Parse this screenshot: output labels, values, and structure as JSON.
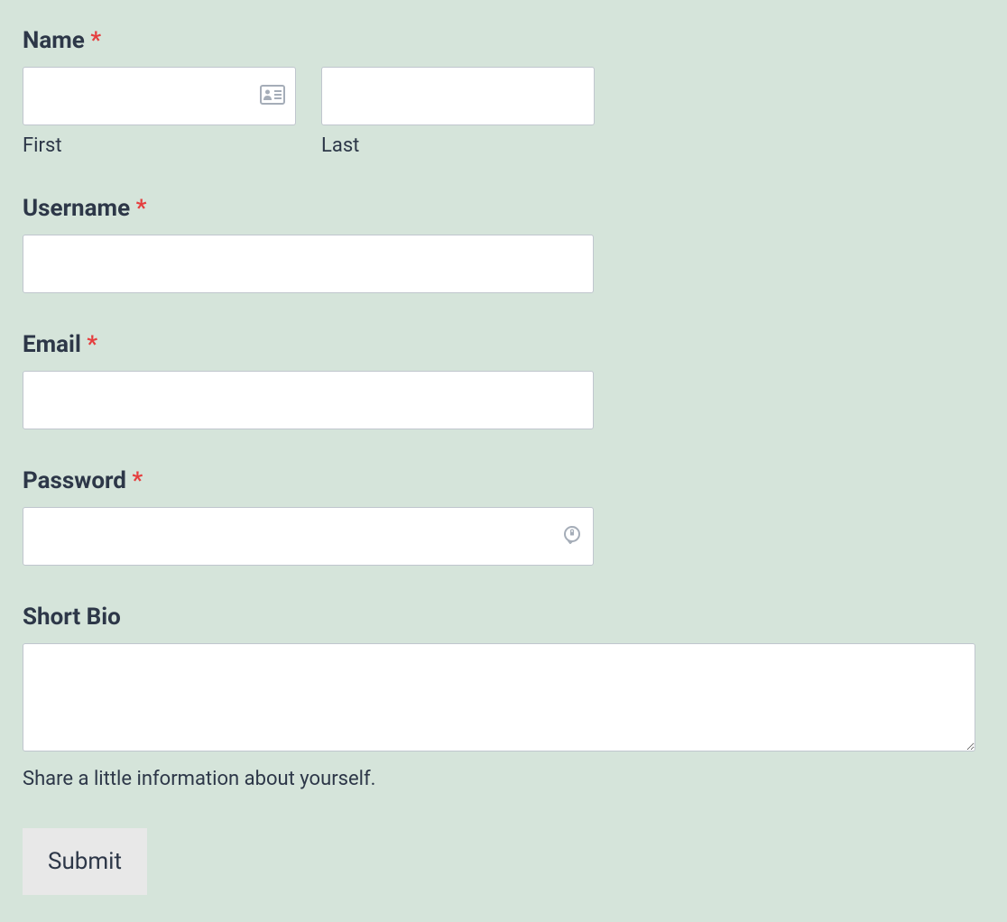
{
  "form": {
    "name": {
      "label": "Name",
      "required_mark": "*",
      "first_sublabel": "First",
      "last_sublabel": "Last",
      "first_value": "",
      "last_value": ""
    },
    "username": {
      "label": "Username",
      "required_mark": "*",
      "value": ""
    },
    "email": {
      "label": "Email",
      "required_mark": "*",
      "value": ""
    },
    "password": {
      "label": "Password",
      "required_mark": "*",
      "value": ""
    },
    "bio": {
      "label": "Short Bio",
      "value": "",
      "helper": "Share a little information about yourself."
    },
    "submit_label": "Submit"
  }
}
